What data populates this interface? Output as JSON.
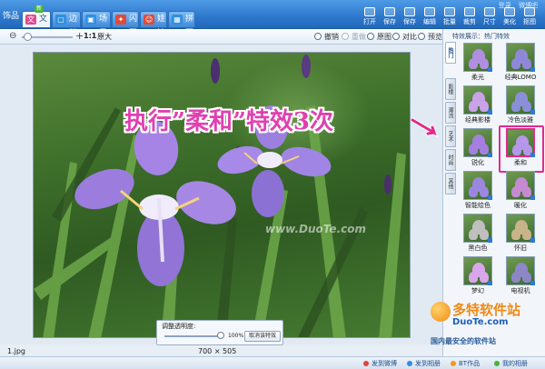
{
  "app": {
    "brand": "饰品"
  },
  "nav_tabs": [
    {
      "label": "文字",
      "icon": "text-icon",
      "color": "#e04a8f",
      "badge": "新"
    },
    {
      "label": "边框",
      "icon": "frame-icon",
      "color": "#2f8fe0"
    },
    {
      "label": "场景",
      "icon": "scene-icon",
      "color": "#2f8fe0"
    },
    {
      "label": "闪图",
      "icon": "flash-icon",
      "color": "#e04a3a"
    },
    {
      "label": "娃娃",
      "icon": "doll-icon",
      "color": "#e04a3a"
    },
    {
      "label": "拼图",
      "icon": "puzzle-icon",
      "color": "#2f8fe0"
    }
  ],
  "window_links": [
    "登录",
    "微博吧"
  ],
  "top_tools": [
    "打开",
    "保存",
    "保存",
    "编辑",
    "批量",
    "裁剪",
    "尺寸",
    "美化",
    "抠图"
  ],
  "toolbar2": {
    "zoom_ratio": "1:1",
    "zoom_label": "原大",
    "buttons": [
      {
        "label": "撤销",
        "icon": "undo-icon",
        "disabled": false
      },
      {
        "label": "重做",
        "icon": "redo-icon",
        "disabled": true
      },
      {
        "label": "原图",
        "icon": "original-icon",
        "disabled": false
      },
      {
        "label": "对比",
        "icon": "compare-icon",
        "disabled": false
      },
      {
        "label": "预览",
        "icon": "preview-icon",
        "disabled": false
      }
    ]
  },
  "canvas": {
    "caption": "执行”柔和”特效3次",
    "watermark": "www.DuoTe.com",
    "opacity_panel": {
      "title": "调整透明度:",
      "value": "100%",
      "cancel": "取消该特效"
    },
    "filename": "1.jpg",
    "dimensions": "700 × 505"
  },
  "effects_panel": {
    "breadcrumb": "特效展示：热门特效",
    "side_tabs": [
      "热门",
      "影楼",
      "潮流",
      "艺术",
      "时尚",
      "其他"
    ],
    "effects": [
      {
        "label": "柔光",
        "petal": "#b08ee0"
      },
      {
        "label": "经典LOMO",
        "petal": "#8f88d8"
      },
      {
        "label": "经典影楼",
        "petal": "#c9a2e8"
      },
      {
        "label": "冷色淡雅",
        "petal": "#8a8fd8"
      },
      {
        "label": "锐化",
        "petal": "#a47fdf"
      },
      {
        "label": "柔和",
        "petal": "#b696ea",
        "selected": true
      },
      {
        "label": "智能绘色",
        "petal": "#9b86e0"
      },
      {
        "label": "暖化",
        "petal": "#c48bd0"
      },
      {
        "label": "黑白色",
        "petal": "#bfbfbf"
      },
      {
        "label": "怀旧",
        "petal": "#c9b38a"
      },
      {
        "label": "梦幻",
        "petal": "#d9a6ec"
      },
      {
        "label": "电视机",
        "petal": "#8d86c7"
      }
    ]
  },
  "site_logo": {
    "main": "多特软件站",
    "domain": "DuoTe.com",
    "slogan": "国内最安全的软件站"
  },
  "statusbar": [
    {
      "label": "发到微博",
      "color": "#e0433a"
    },
    {
      "label": "发到相册",
      "color": "#2f8fe0"
    },
    {
      "label": "BT作品",
      "color": "#f09a1a"
    },
    {
      "label": "我的相册",
      "color": "#46b335"
    }
  ]
}
